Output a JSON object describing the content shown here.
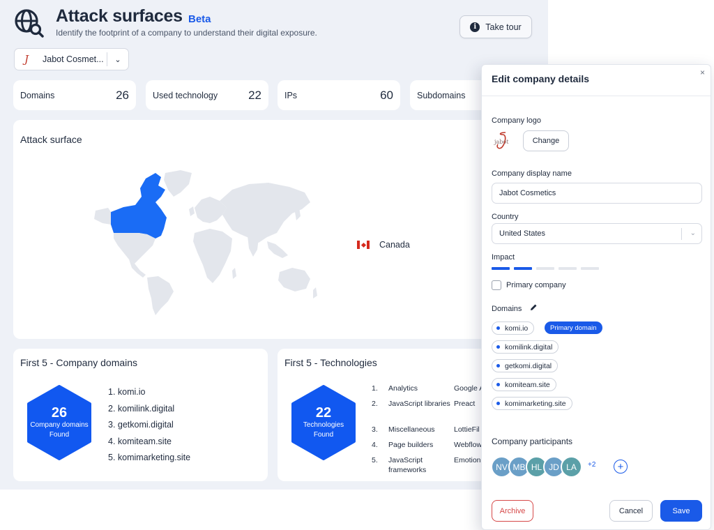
{
  "header": {
    "title": "Attack surfaces",
    "badge": "Beta",
    "subtitle": "Identify the footprint of a company to understand their digital exposure.",
    "tour_label": "Take tour",
    "icon": "globe-search-icon"
  },
  "company_select": {
    "value": "Jabot Cosmet...",
    "icon": "chevron-down-icon"
  },
  "stats": [
    {
      "label": "Domains",
      "value": "26"
    },
    {
      "label": "Used technology",
      "value": "22"
    },
    {
      "label": "IPs",
      "value": "60"
    },
    {
      "label": "Subdomains",
      "value": ""
    }
  ],
  "attack_surface": {
    "title": "Attack surface",
    "legend": [
      {
        "country": "Canada",
        "flag": "canada-flag-icon"
      }
    ],
    "colors": {
      "highlight": "#1a6cf5",
      "land": "#e3e6ec"
    }
  },
  "domains_panel": {
    "title": "First 5 - Company domains",
    "count": "26",
    "count_label_1": "Company domains",
    "count_label_2": "Found",
    "items": [
      "1. komi.io",
      "2. komilink.digital",
      "3. getkomi.digital",
      "4. komiteam.site",
      "5. komimarketing.site"
    ]
  },
  "tech_panel": {
    "title": "First 5 - Technologies",
    "count": "22",
    "count_label_1": "Technologies",
    "count_label_2": "Found",
    "rows": [
      {
        "n": "1.",
        "category": "Analytics",
        "tech": "Google A"
      },
      {
        "n": "2.",
        "category": "JavaScript libraries",
        "tech": "Preact"
      },
      {
        "n": "3.",
        "category": "Miscellaneous",
        "tech": "LottieFil"
      },
      {
        "n": "4.",
        "category": "Page builders",
        "tech": "Webflow"
      },
      {
        "n": "5.",
        "category": "JavaScript frameworks",
        "tech": "Emotion"
      }
    ]
  },
  "modal": {
    "title": "Edit company details",
    "close": "×",
    "logo_label": "Company logo",
    "change_label": "Change",
    "name_label": "Company display name",
    "name_value": "Jabot Cosmetics",
    "country_label": "Country",
    "country_value": "United States",
    "impact_label": "Impact",
    "impact_level": 2,
    "impact_max": 5,
    "primary_label": "Primary company",
    "primary_checked": false,
    "domains_label": "Domains",
    "domains": [
      "komi.io",
      "komilink.digital",
      "getkomi.digital",
      "komiteam.site",
      "komimarketing.site"
    ],
    "primary_domain_label": "Primary domain",
    "participants_label": "Company participants",
    "participants": [
      {
        "initials": "NV",
        "color": "#6a9fc7"
      },
      {
        "initials": "MB",
        "color": "#6a9fc7"
      },
      {
        "initials": "HL",
        "color": "#5ba0a8"
      },
      {
        "initials": "JD",
        "color": "#6a9fc7"
      },
      {
        "initials": "LA",
        "color": "#5ba0a8"
      }
    ],
    "more_count": "+2",
    "add_icon": "plus-circle-icon",
    "archive_label": "Archive",
    "cancel_label": "Cancel",
    "save_label": "Save"
  }
}
